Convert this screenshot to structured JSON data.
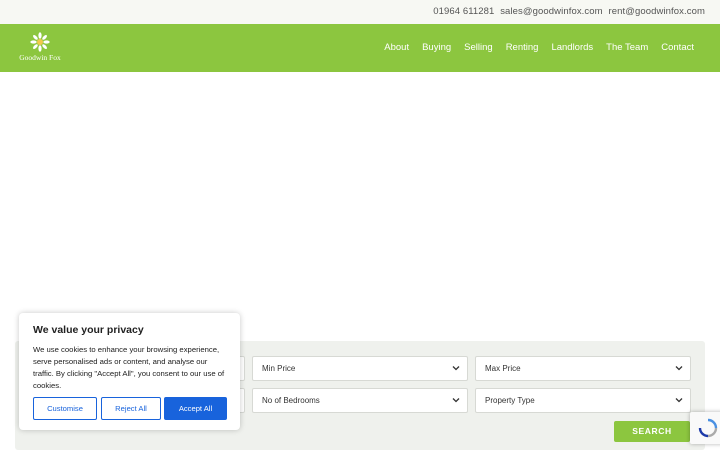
{
  "topbar": {
    "phone": "01964 611281",
    "email_sales": "sales@goodwinfox.com",
    "email_rent": "rent@goodwinfox.com"
  },
  "brand": {
    "name": "Goodwin Fox"
  },
  "nav": {
    "items": [
      {
        "label": "About"
      },
      {
        "label": "Buying"
      },
      {
        "label": "Selling"
      },
      {
        "label": "Renting"
      },
      {
        "label": "Landlords"
      },
      {
        "label": "The Team"
      },
      {
        "label": "Contact"
      }
    ]
  },
  "search": {
    "min_price": "Min Price",
    "max_price": "Max Price",
    "bedrooms": "No of Bedrooms",
    "property_type": "Property Type",
    "button": "SEARCH"
  },
  "cookie": {
    "title": "We value your privacy",
    "body": "We use cookies to enhance your browsing experience, serve personalised ads or content, and analyse our traffic. By clicking \"Accept All\", you consent to our use of cookies.",
    "customise": "Customise",
    "reject": "Reject All",
    "accept": "Accept All"
  },
  "colors": {
    "brand_green": "#8cc63f",
    "cookie_blue": "#1863dc",
    "panel_bg": "#eff1ed"
  },
  "icons": [
    "daisy-logo-icon",
    "chevron-down-icon",
    "recaptcha-icon"
  ]
}
